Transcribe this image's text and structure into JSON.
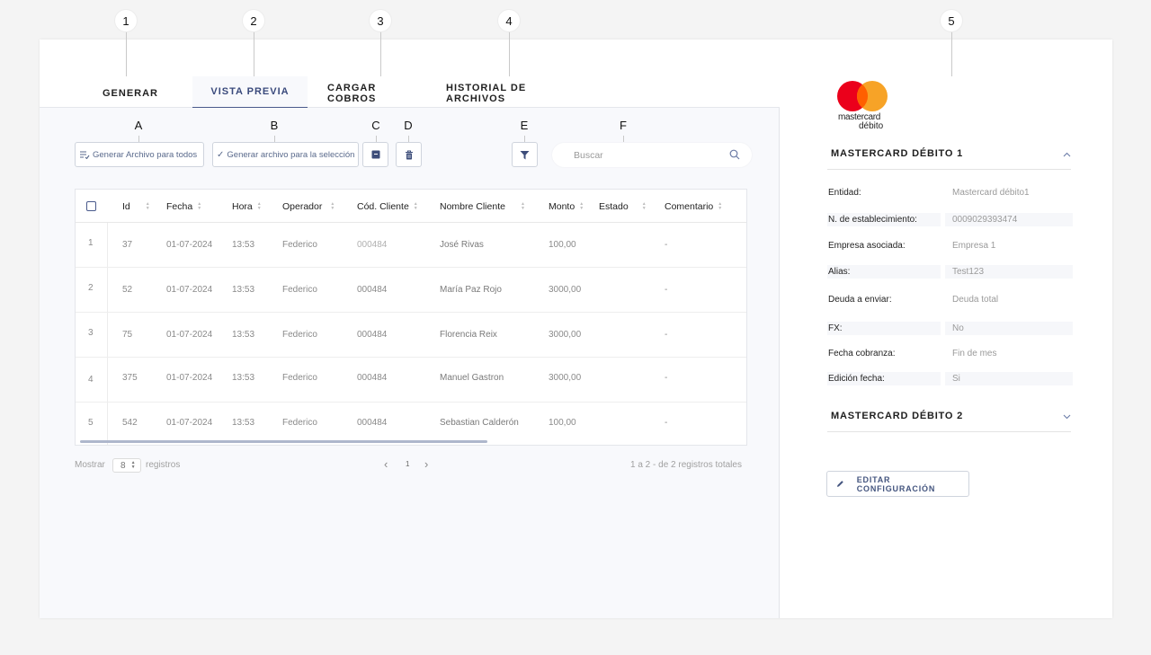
{
  "callouts": [
    "1",
    "2",
    "3",
    "4",
    "5",
    "A",
    "B",
    "C",
    "D",
    "E",
    "F"
  ],
  "tabs": [
    {
      "label": "GENERAR"
    },
    {
      "label": "VISTA PREVIA"
    },
    {
      "label": "CARGAR COBROS"
    },
    {
      "label": "HISTORIAL DE ARCHIVOS"
    }
  ],
  "toolbar": {
    "generate_all": "Generar Archivo para todos",
    "generate_selection": "Generar archivo para la selección",
    "search_placeholder": "Buscar"
  },
  "table": {
    "columns": [
      "Id",
      "Fecha",
      "Hora",
      "Operador",
      "Cód. Cliente",
      "Nombre Cliente",
      "Monto",
      "Estado",
      "Comentario"
    ],
    "rows": [
      {
        "n": "1",
        "id": "37",
        "fecha": "01-07-2024",
        "hora": "13:53",
        "operador": "Federico",
        "cod": "000484",
        "nombre": "José Rivas",
        "monto": "100,00",
        "estado": "",
        "comentario": "-"
      },
      {
        "n": "2",
        "id": "52",
        "fecha": "01-07-2024",
        "hora": "13:53",
        "operador": "Federico",
        "cod": "000484",
        "nombre": "María Paz Rojo",
        "monto": "3000,00",
        "estado": "",
        "comentario": "-"
      },
      {
        "n": "3",
        "id": "75",
        "fecha": "01-07-2024",
        "hora": "13:53",
        "operador": "Federico",
        "cod": "000484",
        "nombre": "Florencia Reix",
        "monto": "3000,00",
        "estado": "",
        "comentario": "-"
      },
      {
        "n": "4",
        "id": "375",
        "fecha": "01-07-2024",
        "hora": "13:53",
        "operador": "Federico",
        "cod": "000484",
        "nombre": "Manuel Gastron",
        "monto": "3000,00",
        "estado": "",
        "comentario": "-"
      },
      {
        "n": "5",
        "id": "542",
        "fecha": "01-07-2024",
        "hora": "13:53",
        "operador": "Federico",
        "cod": "000484",
        "nombre": "Sebastian Calderón",
        "monto": "100,00",
        "estado": "",
        "comentario": "-"
      }
    ]
  },
  "pager": {
    "show_label": "Mostrar",
    "page_size": "8",
    "records_label": "registros",
    "prev": "‹",
    "page": "1",
    "next": "›",
    "summary": "1 a 2 - de 2 registros totales"
  },
  "panel": {
    "logo_text_1": "mastercard",
    "logo_text_2": "débito",
    "section1_title": "MASTERCARD DÉBITO 1",
    "fields": [
      {
        "label": "Entidad:",
        "value": "Mastercard débito1"
      },
      {
        "label": "N. de establecimiento:",
        "value": "0009029393474"
      },
      {
        "label": "Empresa asociada:",
        "value": "Empresa 1"
      },
      {
        "label": "Alias:",
        "value": "Test123"
      },
      {
        "label": "Deuda a enviar:",
        "value": "Deuda total"
      },
      {
        "label": "FX:",
        "value": "No"
      },
      {
        "label": "Fecha cobranza:",
        "value": "Fin de mes"
      },
      {
        "label": "Edición fecha:",
        "value": "Si"
      }
    ],
    "section2_title": "MASTERCARD DÉBITO 2",
    "edit_button": "EDITAR CONFIGURACIÓN"
  },
  "colors": {
    "accent": "#3a4a7c",
    "mastercard_red": "#eb001b",
    "mastercard_orange": "#f79e1b"
  }
}
